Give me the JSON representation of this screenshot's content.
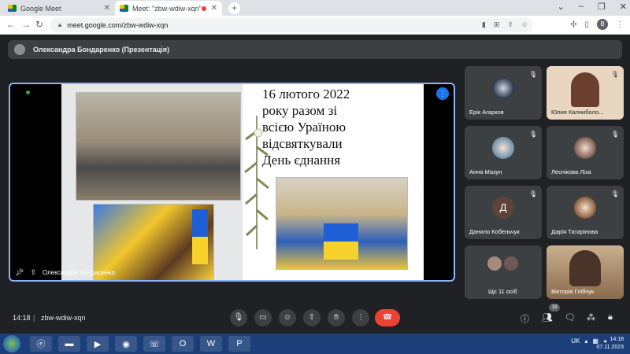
{
  "browser": {
    "tabs": [
      {
        "title": "Google Meet",
        "active": false
      },
      {
        "title": "Meet: \"zbw-wdiw-xqn\"",
        "active": true
      }
    ],
    "url": "meet.google.com/zbw-wdiw-xqn",
    "profile_initial": "B"
  },
  "meet": {
    "presenter_banner": "Олександра Бондаренко (Презентація)",
    "stage_caption": "Олександра Бондаренко",
    "slide": {
      "lines": [
        "16 лютого  2022",
        "року разом зі",
        "всією Ураїною",
        "відсвяткували",
        "День єднання"
      ]
    },
    "participants": [
      {
        "name": "Ерік Агарков",
        "muted": true,
        "kind": "avatar"
      },
      {
        "name": "Юлия Калниболо...",
        "muted": true,
        "kind": "video"
      },
      {
        "name": "Анна Мазун",
        "muted": true,
        "kind": "avatar"
      },
      {
        "name": "Леснікова Ліза",
        "muted": true,
        "kind": "avatar"
      },
      {
        "name": "Данило Кобельчук",
        "muted": true,
        "kind": "letter",
        "letter": "Д"
      },
      {
        "name": "Дарія Татарінова",
        "muted": true,
        "kind": "avatar"
      },
      {
        "name": "Щє 11 осіб",
        "muted": false,
        "kind": "group"
      },
      {
        "name": "Вікторія Глібчук",
        "muted": false,
        "kind": "video"
      }
    ],
    "bottom": {
      "time": "14:18",
      "separator": "|",
      "code": "zbw-wdiw-xqn",
      "people_count": "19"
    }
  },
  "taskbar": {
    "lang": "UK",
    "time": "14:18",
    "date": "07.11.2023"
  }
}
